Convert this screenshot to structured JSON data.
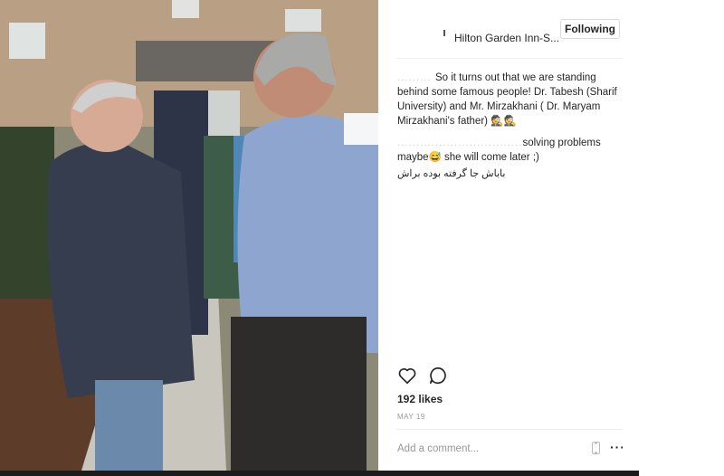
{
  "post": {
    "location": "Hilton Garden Inn-S...",
    "follow_label": "Following",
    "caption_lines": [
      "So it turns out that we are standing behind some famous people! Dr. Tabesh (Sharif University) and Mr. Mirzakhani ( Dr. Maryam Mirzakhani's father) 🕵🕵",
      "solving problems maybe😅 she will come later ;)",
      "باباش جا گرفته بوده براش"
    ],
    "likes": "192 likes",
    "date": "MAY 19",
    "comment_placeholder": "Add a comment..."
  },
  "icons": {
    "like": "heart-icon",
    "comment": "comment-bubble-icon",
    "more": "more-options-icon",
    "location": "location-pin-icon"
  },
  "colors": {
    "text": "#262626",
    "muted": "#999999",
    "border": "#dbdbdb"
  }
}
